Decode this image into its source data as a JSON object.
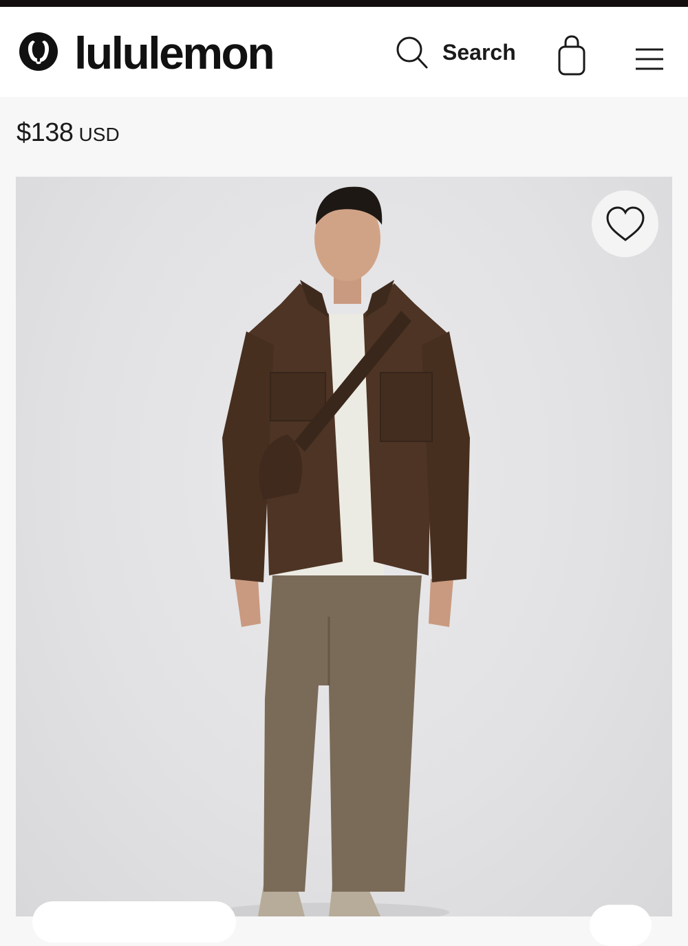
{
  "header": {
    "brand": "lululemon",
    "search_label": "Search"
  },
  "product": {
    "price_amount": "$138",
    "price_currency": "USD",
    "image_alt": "Model wearing brown button-up overshirt, white tee, taupe pants and crossbody bag"
  },
  "colors": {
    "top_bar": "#140f0f",
    "header_bg": "#ffffff",
    "page_bg": "#f7f7f7",
    "shirt": "#4e3424",
    "pants": "#7a6a58"
  },
  "icons": [
    "lululemon-logo-icon",
    "search-icon",
    "shopping-bag-icon",
    "hamburger-menu-icon",
    "heart-icon"
  ]
}
